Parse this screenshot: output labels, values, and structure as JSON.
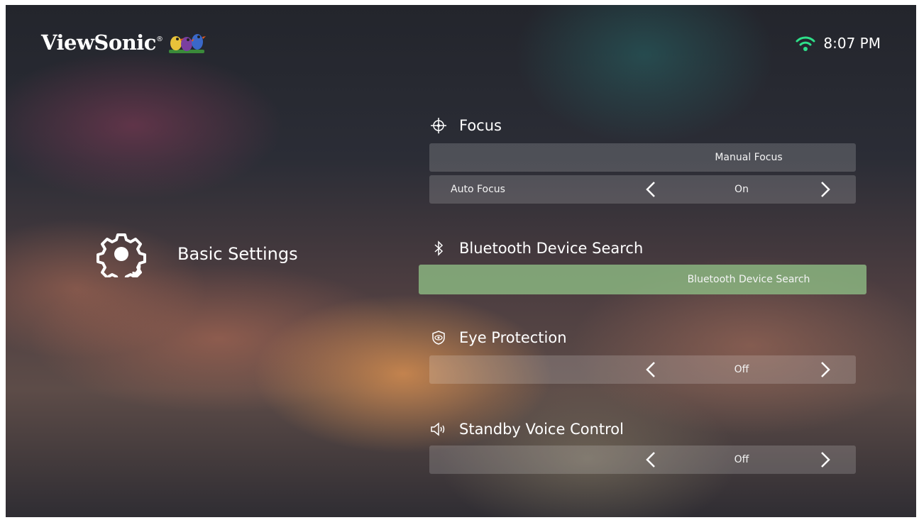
{
  "brand": {
    "name": "ViewSonic",
    "registered": "®"
  },
  "status": {
    "time": "8:07 PM",
    "wifi_icon": "wifi-icon"
  },
  "category": {
    "label": "Basic Settings",
    "icon": "gear-icon"
  },
  "colors": {
    "selected_row": "#8cb982",
    "wifi": "#2ee08a"
  },
  "sections": {
    "focus": {
      "title": "Focus",
      "icon": "crosshair-icon",
      "manual_label": "Manual Focus",
      "auto_label": "Auto Focus",
      "auto_value": "On"
    },
    "bluetooth": {
      "title": "Bluetooth Device Search",
      "icon": "bluetooth-icon",
      "button_label": "Bluetooth Device Search"
    },
    "eye": {
      "title": "Eye Protection",
      "icon": "eye-shield-icon",
      "value": "Off"
    },
    "voice": {
      "title": "Standby Voice Control",
      "icon": "speaker-icon",
      "value": "Off"
    }
  }
}
